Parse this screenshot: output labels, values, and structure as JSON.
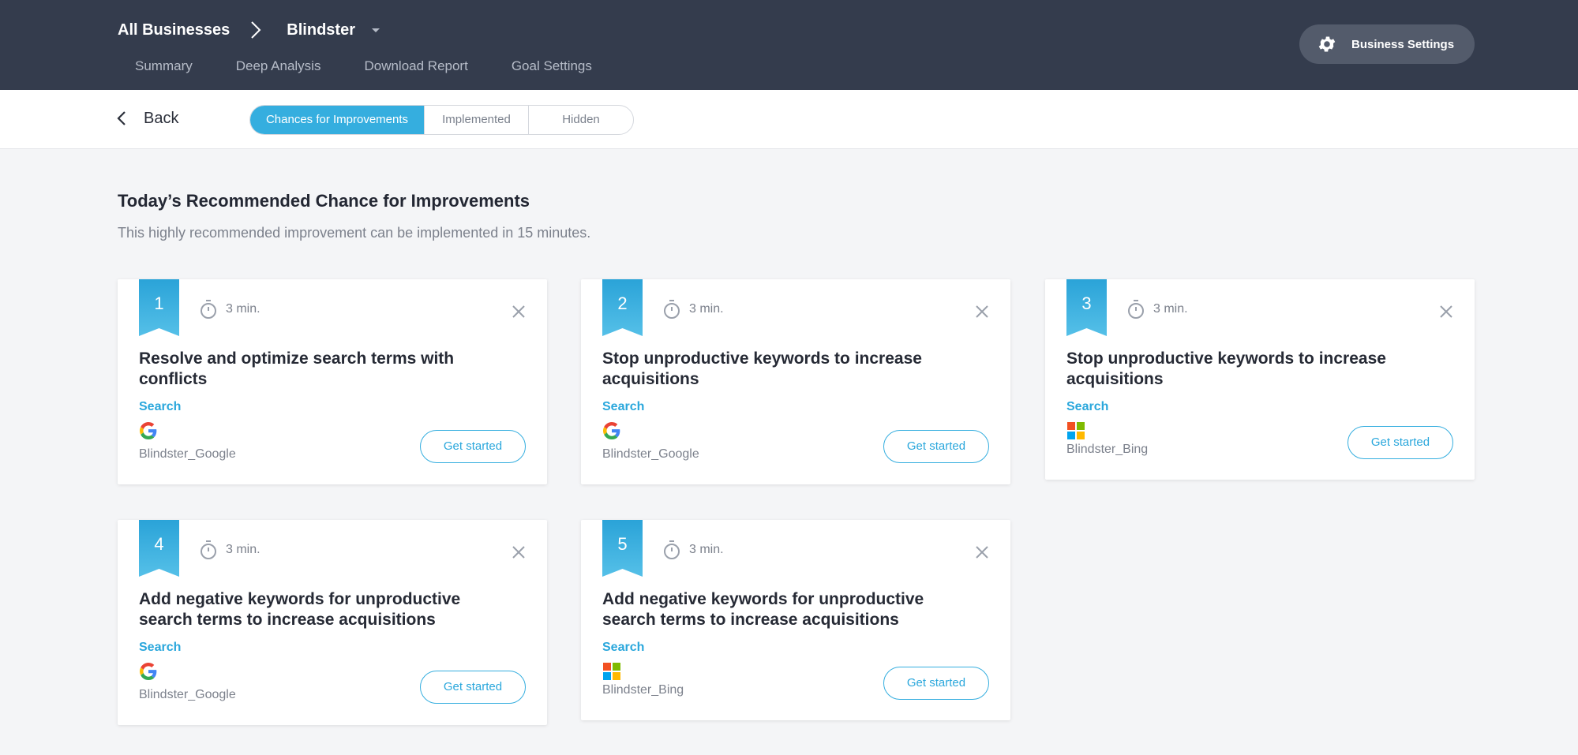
{
  "header": {
    "breadcrumb_root": "All Businesses",
    "breadcrumb_current": "Blindster",
    "nav": [
      "Summary",
      "Deep Analysis",
      "Download Report",
      "Goal Settings"
    ],
    "settings_label": "Business Settings"
  },
  "subbar": {
    "back_label": "Back",
    "tabs": [
      "Chances for Improvements",
      "Implemented",
      "Hidden"
    ],
    "active_tab": "Chances for Improvements"
  },
  "main": {
    "title": "Today’s Recommended Chance for Improvements",
    "subtitle": "This highly recommended improvement can be implemented in 15 minutes."
  },
  "cards": [
    {
      "rank": "1",
      "duration": "3 min.",
      "title": "Resolve and optimize search terms with conflicts",
      "category": "Search",
      "platform": "google",
      "account": "Blindster_Google",
      "action": "Get started"
    },
    {
      "rank": "2",
      "duration": "3 min.",
      "title": "Stop unproductive keywords to increase acquisitions",
      "category": "Search",
      "platform": "google",
      "account": "Blindster_Google",
      "action": "Get started"
    },
    {
      "rank": "3",
      "duration": "3 min.",
      "title": "Stop unproductive keywords to increase acquisitions",
      "category": "Search",
      "platform": "bing",
      "account": "Blindster_Bing",
      "action": "Get started"
    },
    {
      "rank": "4",
      "duration": "3 min.",
      "title": "Add negative keywords for unproductive search terms to increase acquisitions",
      "category": "Search",
      "platform": "google",
      "account": "Blindster_Google",
      "action": "Get started"
    },
    {
      "rank": "5",
      "duration": "3 min.",
      "title": "Add negative keywords for unproductive search terms to increase acquisitions",
      "category": "Search",
      "platform": "bing",
      "account": "Blindster_Bing",
      "action": "Get started"
    }
  ],
  "colors": {
    "header_bg": "#343c4d",
    "accent": "#35aedf",
    "page_bg": "#f4f5f7"
  }
}
